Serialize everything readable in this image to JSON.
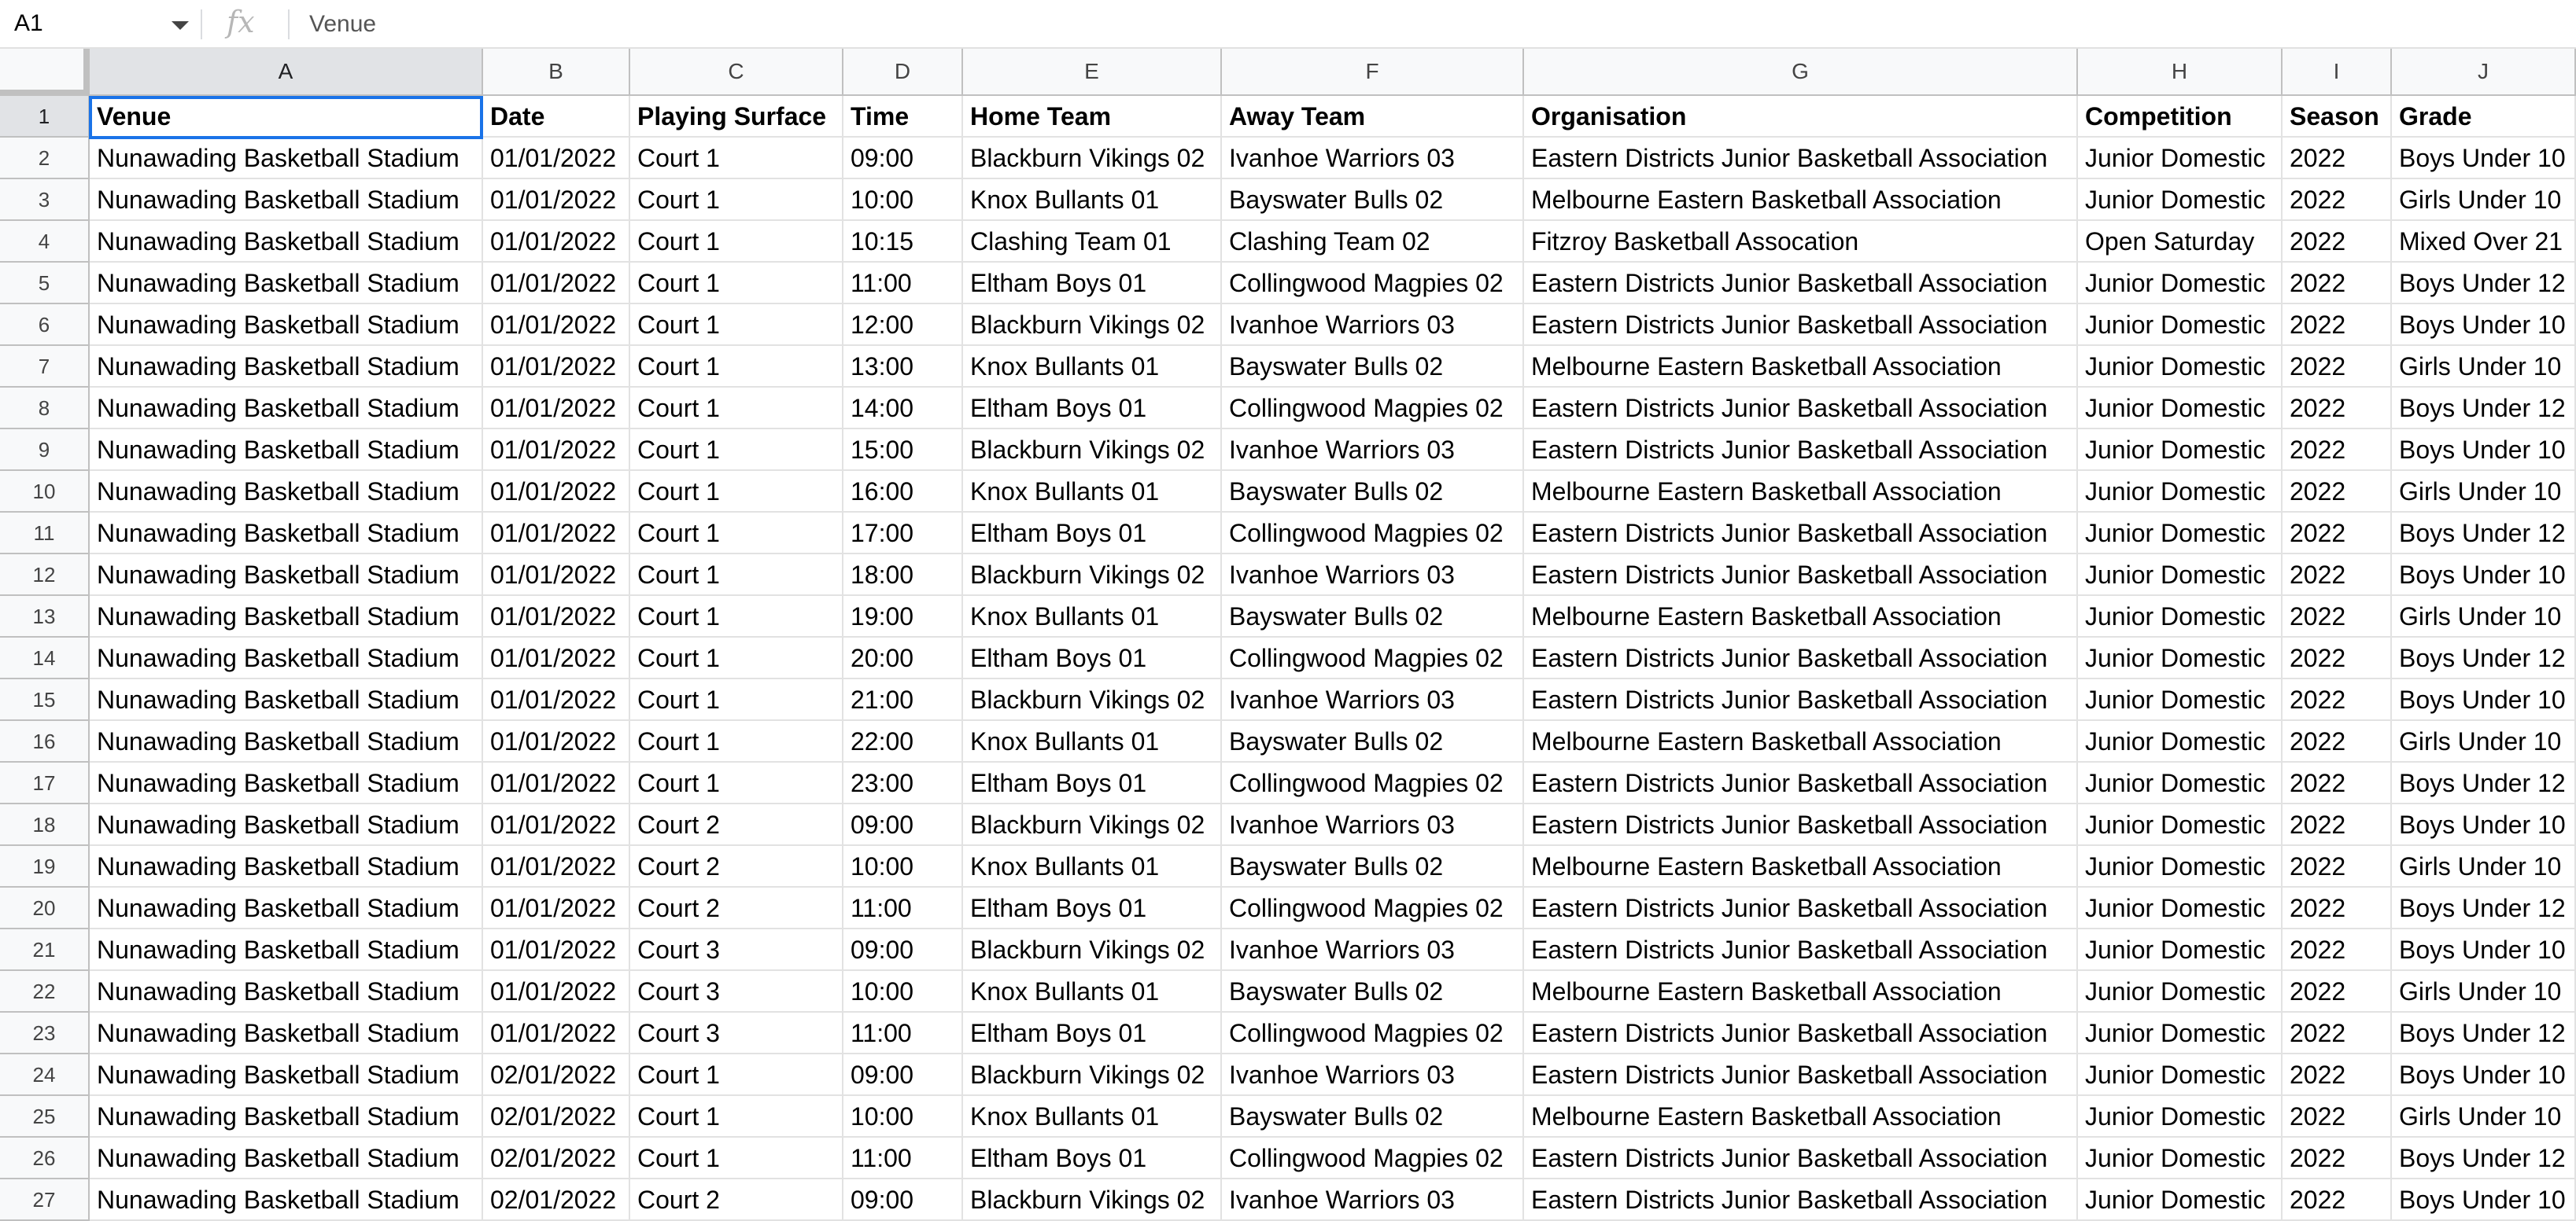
{
  "formula_bar": {
    "name_box": "A1",
    "fx_label": "fx",
    "content": "Venue"
  },
  "columns": [
    "A",
    "B",
    "C",
    "D",
    "E",
    "F",
    "G",
    "H",
    "I",
    "J"
  ],
  "rows": [
    [
      "Venue",
      "Date",
      "Playing Surface",
      "Time",
      "Home Team",
      "Away Team",
      "Organisation",
      "Competition",
      "Season",
      "Grade"
    ],
    [
      "Nunawading Basketball Stadium",
      "01/01/2022",
      "Court 1",
      "09:00",
      "Blackburn Vikings 02",
      "Ivanhoe Warriors 03",
      "Eastern Districts Junior Basketball Association",
      "Junior Domestic",
      "2022",
      "Boys Under 10"
    ],
    [
      "Nunawading Basketball Stadium",
      "01/01/2022",
      "Court 1",
      "10:00",
      "Knox Bullants 01",
      "Bayswater Bulls 02",
      "Melbourne Eastern Basketball Association",
      "Junior Domestic",
      "2022",
      "Girls Under 10"
    ],
    [
      "Nunawading Basketball Stadium",
      "01/01/2022",
      "Court 1",
      "10:15",
      "Clashing Team 01",
      "Clashing Team 02",
      "Fitzroy Basketball Assocation",
      "Open Saturday",
      "2022",
      "Mixed Over 21"
    ],
    [
      "Nunawading Basketball Stadium",
      "01/01/2022",
      "Court 1",
      "11:00",
      "Eltham Boys 01",
      "Collingwood Magpies 02",
      "Eastern Districts Junior Basketball Association",
      "Junior Domestic",
      "2022",
      "Boys Under 12"
    ],
    [
      "Nunawading Basketball Stadium",
      "01/01/2022",
      "Court 1",
      "12:00",
      "Blackburn Vikings 02",
      "Ivanhoe Warriors 03",
      "Eastern Districts Junior Basketball Association",
      "Junior Domestic",
      "2022",
      "Boys Under 10"
    ],
    [
      "Nunawading Basketball Stadium",
      "01/01/2022",
      "Court 1",
      "13:00",
      "Knox Bullants 01",
      "Bayswater Bulls 02",
      "Melbourne Eastern Basketball Association",
      "Junior Domestic",
      "2022",
      "Girls Under 10"
    ],
    [
      "Nunawading Basketball Stadium",
      "01/01/2022",
      "Court 1",
      "14:00",
      "Eltham Boys 01",
      "Collingwood Magpies 02",
      "Eastern Districts Junior Basketball Association",
      "Junior Domestic",
      "2022",
      "Boys Under 12"
    ],
    [
      "Nunawading Basketball Stadium",
      "01/01/2022",
      "Court 1",
      "15:00",
      "Blackburn Vikings 02",
      "Ivanhoe Warriors 03",
      "Eastern Districts Junior Basketball Association",
      "Junior Domestic",
      "2022",
      "Boys Under 10"
    ],
    [
      "Nunawading Basketball Stadium",
      "01/01/2022",
      "Court 1",
      "16:00",
      "Knox Bullants 01",
      "Bayswater Bulls 02",
      "Melbourne Eastern Basketball Association",
      "Junior Domestic",
      "2022",
      "Girls Under 10"
    ],
    [
      "Nunawading Basketball Stadium",
      "01/01/2022",
      "Court 1",
      "17:00",
      "Eltham Boys 01",
      "Collingwood Magpies 02",
      "Eastern Districts Junior Basketball Association",
      "Junior Domestic",
      "2022",
      "Boys Under 12"
    ],
    [
      "Nunawading Basketball Stadium",
      "01/01/2022",
      "Court 1",
      "18:00",
      "Blackburn Vikings 02",
      "Ivanhoe Warriors 03",
      "Eastern Districts Junior Basketball Association",
      "Junior Domestic",
      "2022",
      "Boys Under 10"
    ],
    [
      "Nunawading Basketball Stadium",
      "01/01/2022",
      "Court 1",
      "19:00",
      "Knox Bullants 01",
      "Bayswater Bulls 02",
      "Melbourne Eastern Basketball Association",
      "Junior Domestic",
      "2022",
      "Girls Under 10"
    ],
    [
      "Nunawading Basketball Stadium",
      "01/01/2022",
      "Court 1",
      "20:00",
      "Eltham Boys 01",
      "Collingwood Magpies 02",
      "Eastern Districts Junior Basketball Association",
      "Junior Domestic",
      "2022",
      "Boys Under 12"
    ],
    [
      "Nunawading Basketball Stadium",
      "01/01/2022",
      "Court 1",
      "21:00",
      "Blackburn Vikings 02",
      "Ivanhoe Warriors 03",
      "Eastern Districts Junior Basketball Association",
      "Junior Domestic",
      "2022",
      "Boys Under 10"
    ],
    [
      "Nunawading Basketball Stadium",
      "01/01/2022",
      "Court 1",
      "22:00",
      "Knox Bullants 01",
      "Bayswater Bulls 02",
      "Melbourne Eastern Basketball Association",
      "Junior Domestic",
      "2022",
      "Girls Under 10"
    ],
    [
      "Nunawading Basketball Stadium",
      "01/01/2022",
      "Court 1",
      "23:00",
      "Eltham Boys 01",
      "Collingwood Magpies 02",
      "Eastern Districts Junior Basketball Association",
      "Junior Domestic",
      "2022",
      "Boys Under 12"
    ],
    [
      "Nunawading Basketball Stadium",
      "01/01/2022",
      "Court 2",
      "09:00",
      "Blackburn Vikings 02",
      "Ivanhoe Warriors 03",
      "Eastern Districts Junior Basketball Association",
      "Junior Domestic",
      "2022",
      "Boys Under 10"
    ],
    [
      "Nunawading Basketball Stadium",
      "01/01/2022",
      "Court 2",
      "10:00",
      "Knox Bullants 01",
      "Bayswater Bulls 02",
      "Melbourne Eastern Basketball Association",
      "Junior Domestic",
      "2022",
      "Girls Under 10"
    ],
    [
      "Nunawading Basketball Stadium",
      "01/01/2022",
      "Court 2",
      "11:00",
      "Eltham Boys 01",
      "Collingwood Magpies 02",
      "Eastern Districts Junior Basketball Association",
      "Junior Domestic",
      "2022",
      "Boys Under 12"
    ],
    [
      "Nunawading Basketball Stadium",
      "01/01/2022",
      "Court 3",
      "09:00",
      "Blackburn Vikings 02",
      "Ivanhoe Warriors 03",
      "Eastern Districts Junior Basketball Association",
      "Junior Domestic",
      "2022",
      "Boys Under 10"
    ],
    [
      "Nunawading Basketball Stadium",
      "01/01/2022",
      "Court 3",
      "10:00",
      "Knox Bullants 01",
      "Bayswater Bulls 02",
      "Melbourne Eastern Basketball Association",
      "Junior Domestic",
      "2022",
      "Girls Under 10"
    ],
    [
      "Nunawading Basketball Stadium",
      "01/01/2022",
      "Court 3",
      "11:00",
      "Eltham Boys 01",
      "Collingwood Magpies 02",
      "Eastern Districts Junior Basketball Association",
      "Junior Domestic",
      "2022",
      "Boys Under 12"
    ],
    [
      "Nunawading Basketball Stadium",
      "02/01/2022",
      "Court 1",
      "09:00",
      "Blackburn Vikings 02",
      "Ivanhoe Warriors 03",
      "Eastern Districts Junior Basketball Association",
      "Junior Domestic",
      "2022",
      "Boys Under 10"
    ],
    [
      "Nunawading Basketball Stadium",
      "02/01/2022",
      "Court 1",
      "10:00",
      "Knox Bullants 01",
      "Bayswater Bulls 02",
      "Melbourne Eastern Basketball Association",
      "Junior Domestic",
      "2022",
      "Girls Under 10"
    ],
    [
      "Nunawading Basketball Stadium",
      "02/01/2022",
      "Court 1",
      "11:00",
      "Eltham Boys 01",
      "Collingwood Magpies 02",
      "Eastern Districts Junior Basketball Association",
      "Junior Domestic",
      "2022",
      "Boys Under 12"
    ],
    [
      "Nunawading Basketball Stadium",
      "02/01/2022",
      "Court 2",
      "09:00",
      "Blackburn Vikings 02",
      "Ivanhoe Warriors 03",
      "Eastern Districts Junior Basketball Association",
      "Junior Domestic",
      "2022",
      "Boys Under 10"
    ]
  ],
  "active_cell": "A1"
}
